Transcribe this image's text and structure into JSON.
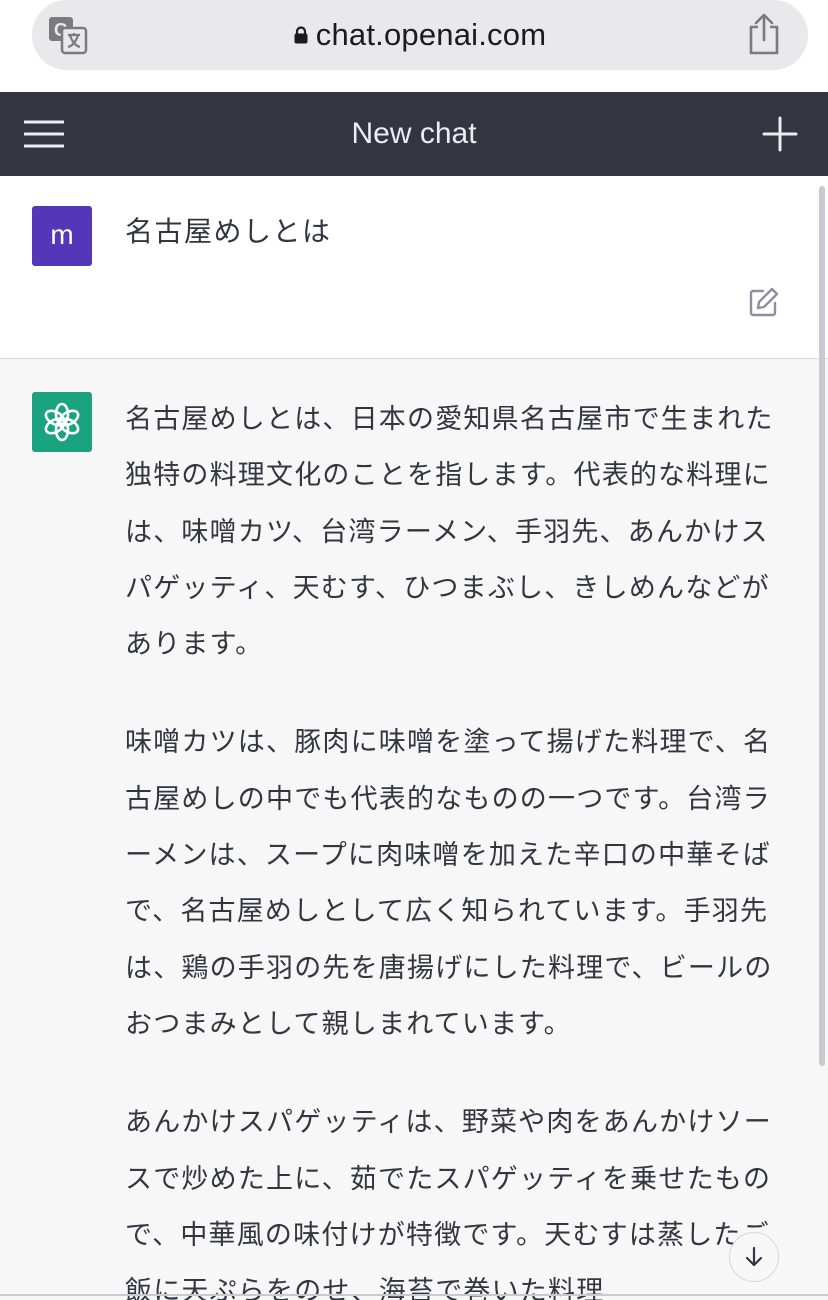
{
  "browser": {
    "url": "chat.openai.com"
  },
  "navbar": {
    "title": "New chat"
  },
  "user_message": {
    "avatar_letter": "m",
    "text": "名古屋めしとは"
  },
  "assistant_message": {
    "paragraphs": [
      "名古屋めしとは、日本の愛知県名古屋市で生まれた独特の料理文化のことを指します。代表的な料理には、味噌カツ、台湾ラーメン、手羽先、あんかけスパゲッティ、天むす、ひつまぶし、きしめんなどがあります。",
      "味噌カツは、豚肉に味噌を塗って揚げた料理で、名古屋めしの中でも代表的なものの一つです。台湾ラーメンは、スープに肉味噌を加えた辛口の中華そばで、名古屋めしとして広く知られています。手羽先は、鶏の手羽の先を唐揚げにした料理で、ビールのおつまみとして親しまれています。",
      "あんかけスパゲッティは、野菜や肉をあんかけソースで炒めた上に、茹でたスパゲッティを乗せたもので、中華風の味付けが特徴です。天むすは蒸したご飯に天ぷらをのせ、海苔で巻いた料理"
    ]
  },
  "colors": {
    "navbar_bg": "#343541",
    "user_avatar": "#5436b8",
    "ai_avatar": "#19a37f",
    "ai_bg": "#f7f7f8"
  },
  "icons": [
    "translate-icon",
    "lock-icon",
    "share-icon",
    "menu-icon",
    "plus-icon",
    "edit-icon",
    "openai-logo-icon",
    "arrow-down-icon"
  ]
}
